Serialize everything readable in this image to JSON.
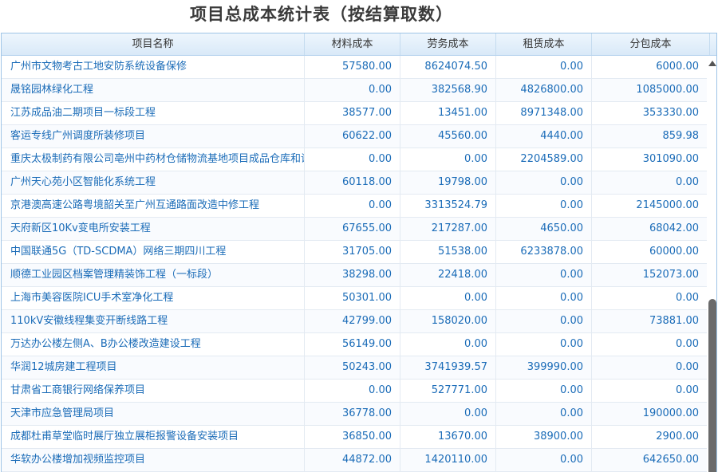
{
  "title": "项目总成本统计表（按结算取数）",
  "columns": [
    "项目名称",
    "材料成本",
    "劳务成本",
    "租赁成本",
    "分包成本"
  ],
  "rows": [
    [
      "广州市文物考古工地安防系统设备保修",
      "57580.00",
      "8624074.50",
      "0.00",
      "6000.00"
    ],
    [
      "晟铭园林绿化工程",
      "0.00",
      "382568.90",
      "4826800.00",
      "1085000.00"
    ],
    [
      "江苏成品油二期项目一标段工程",
      "38577.00",
      "13451.00",
      "8971348.00",
      "353330.00"
    ],
    [
      "客运专线广州调度所装修项目",
      "60622.00",
      "45560.00",
      "4440.00",
      "859.98"
    ],
    [
      "重庆太极制药有限公司亳州中药材仓储物流基地项目成品仓库和设",
      "0.00",
      "0.00",
      "2204589.00",
      "301090.00"
    ],
    [
      "广州天心苑小区智能化系统工程",
      "60118.00",
      "19798.00",
      "0.00",
      "0.00"
    ],
    [
      "京港澳高速公路粤境韶关至广州互通路面改造中修工程",
      "0.00",
      "3313524.79",
      "0.00",
      "2145000.00"
    ],
    [
      "天府新区10Kv变电所安装工程",
      "67655.00",
      "217287.00",
      "4650.00",
      "68042.00"
    ],
    [
      "中国联通5G（TD-SCDMA）网络三期四川工程",
      "31705.00",
      "51538.00",
      "6233878.00",
      "60000.00"
    ],
    [
      "顺德工业园区档案管理精装饰工程（一标段）",
      "38298.00",
      "22418.00",
      "0.00",
      "152073.00"
    ],
    [
      "上海市美容医院ICU手术室净化工程",
      "50301.00",
      "0.00",
      "0.00",
      "0.00"
    ],
    [
      "110kV安徽线程集变开断线路工程",
      "42799.00",
      "158020.00",
      "0.00",
      "73881.00"
    ],
    [
      "万达办公楼左侧A、B办公楼改造建设工程",
      "56149.00",
      "0.00",
      "0.00",
      "0.00"
    ],
    [
      "华润12城房建工程项目",
      "50243.00",
      "3741939.57",
      "399990.00",
      "0.00"
    ],
    [
      "甘肃省工商银行网络保养项目",
      "0.00",
      "527771.00",
      "0.00",
      "0.00"
    ],
    [
      "天津市应急管理局项目",
      "36778.00",
      "0.00",
      "0.00",
      "190000.00"
    ],
    [
      "成都杜甫草堂临时展厅独立展柜报警设备安装项目",
      "36850.00",
      "13670.00",
      "38900.00",
      "2900.00"
    ],
    [
      "华软办公楼增加视频监控项目",
      "44872.00",
      "1420110.00",
      "0.00",
      "642650.00"
    ]
  ]
}
